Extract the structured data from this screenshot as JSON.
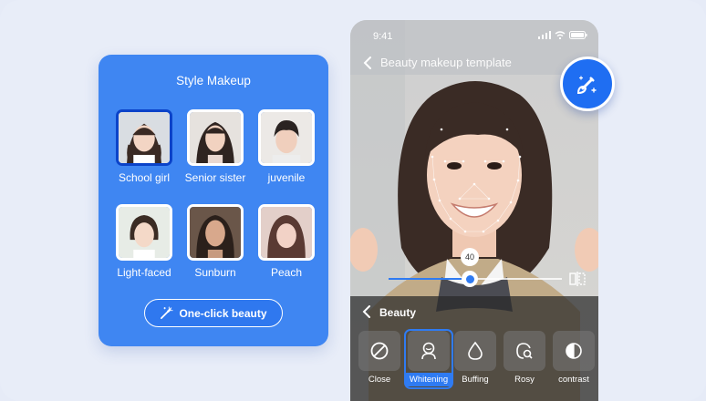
{
  "style_panel": {
    "title": "Style Makeup",
    "styles": [
      {
        "label": "School girl",
        "selected": true
      },
      {
        "label": "Senior sister",
        "selected": false
      },
      {
        "label": "juvenile",
        "selected": false
      },
      {
        "label": "Light-faced",
        "selected": false
      },
      {
        "label": "Sunburn",
        "selected": false
      },
      {
        "label": "Peach",
        "selected": false
      }
    ],
    "one_click_label": "One-click beauty"
  },
  "phone": {
    "status_time": "9:41",
    "nav_title": "Beauty makeup template",
    "slider_value": "40",
    "panel": {
      "title": "Beauty",
      "tools": [
        {
          "label": "Close",
          "icon": "close-circle-icon"
        },
        {
          "label": "Whitening",
          "icon": "face-icon",
          "active": true
        },
        {
          "label": "Buffing",
          "icon": "droplet-icon"
        },
        {
          "label": "Rosy",
          "icon": "blush-icon"
        },
        {
          "label": "contrast",
          "icon": "contrast-icon"
        }
      ]
    }
  },
  "colors": {
    "accent": "#2f7bf2",
    "card": "#3f86f2",
    "background": "#e8edf8"
  }
}
